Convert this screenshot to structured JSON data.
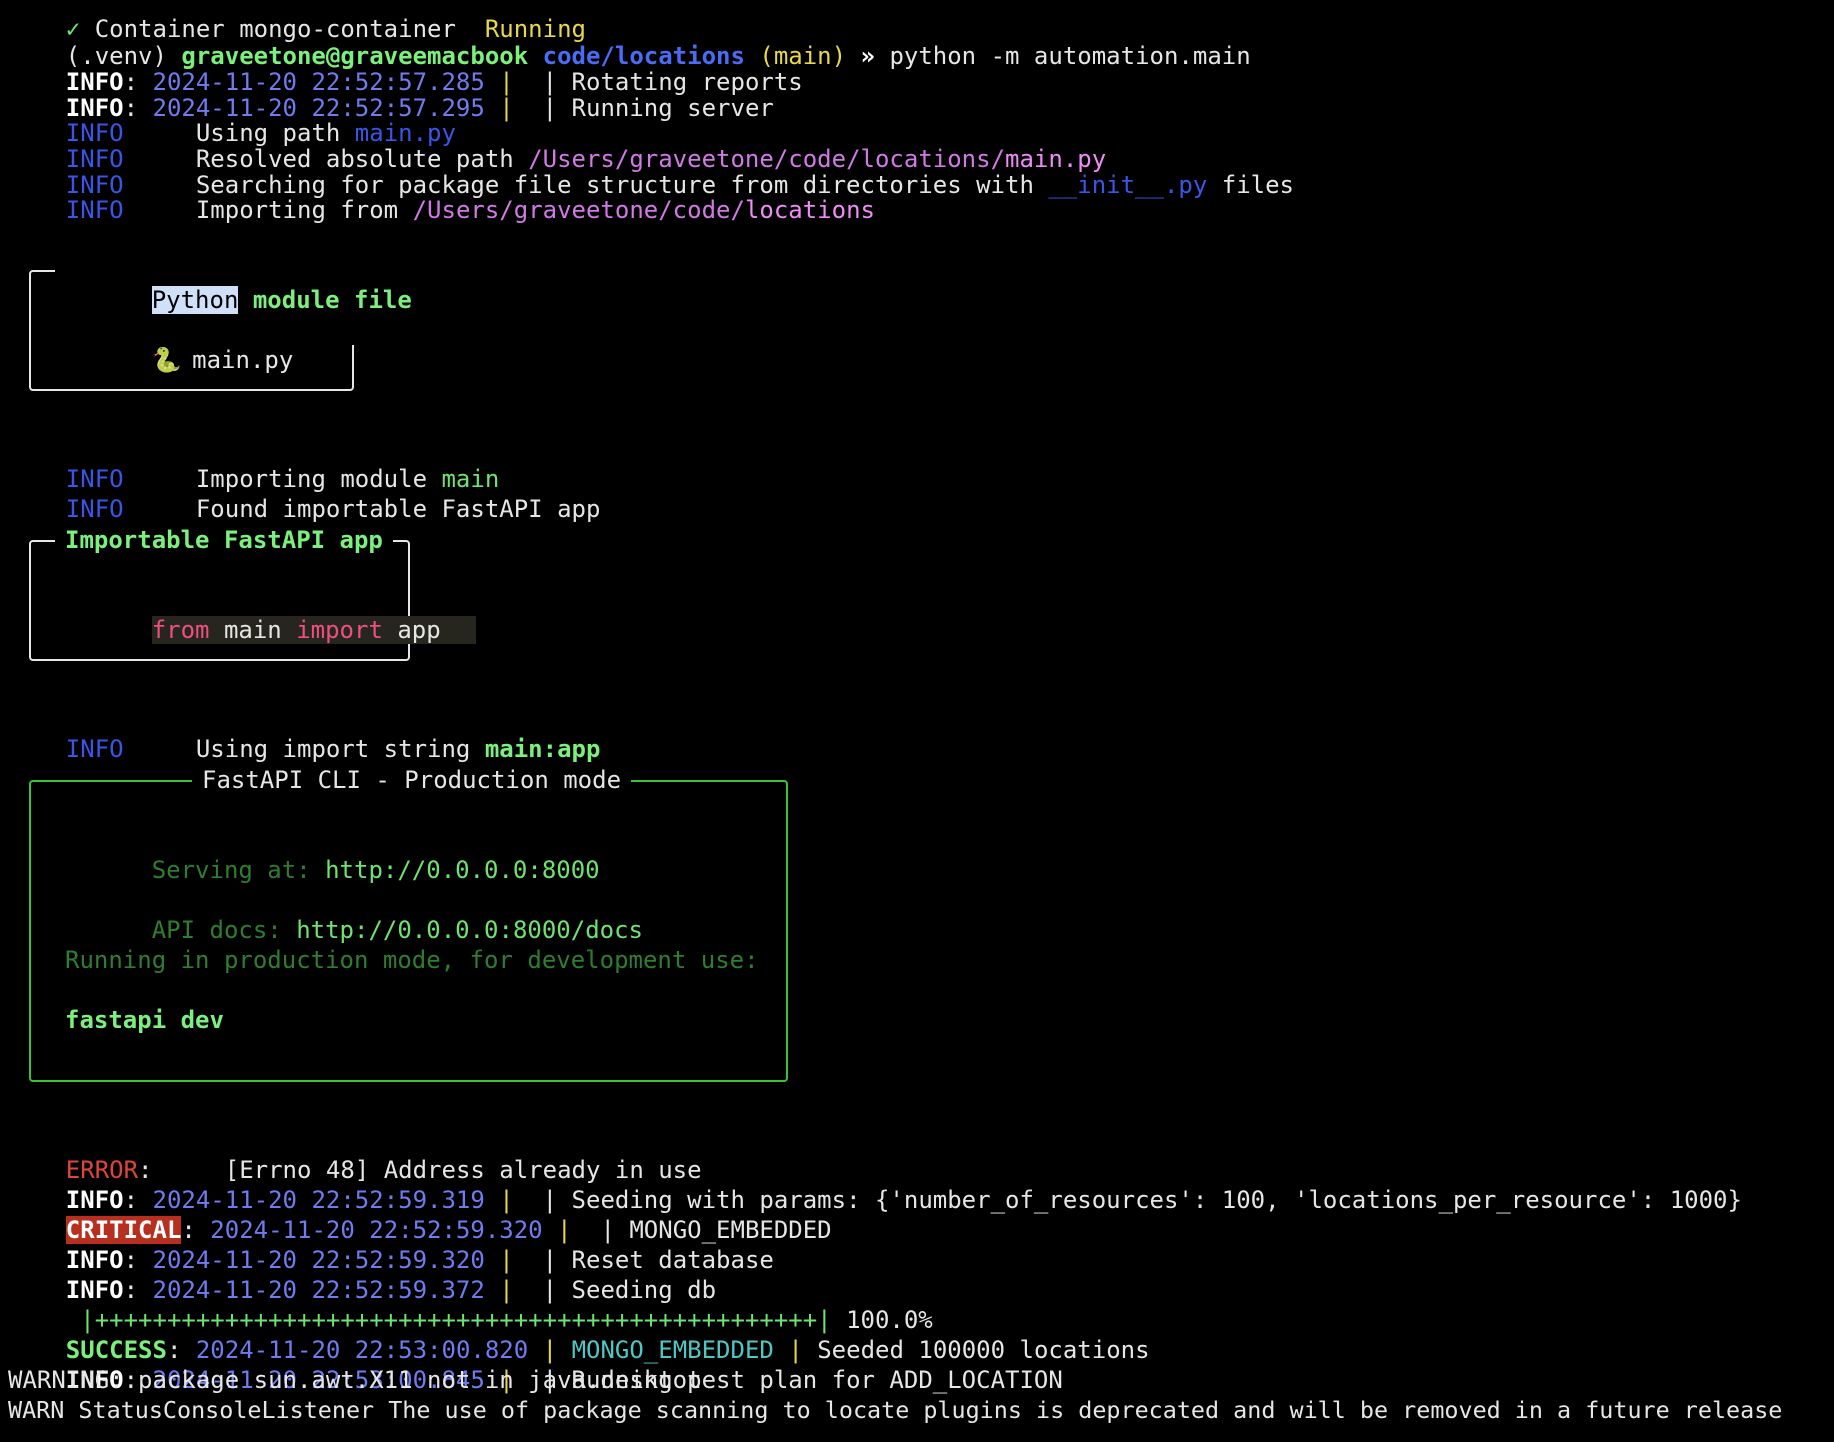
{
  "top_partial": {
    "check": "✓",
    "text": " Container mongo-container  ",
    "status": "Running"
  },
  "prompt": {
    "venv": "(.venv) ",
    "user_host": "graveetone@graveemacbook",
    "path": "code/locations",
    "branch": "(main)",
    "arrow": "»",
    "command": "python -m automation.main"
  },
  "log1": [
    {
      "level": "INFO",
      "time": "2024-11-20 22:52:57.285",
      "msg": "Rotating reports"
    },
    {
      "level": "INFO",
      "time": "2024-11-20 22:52:57.295",
      "msg": "Running server"
    }
  ],
  "cli1": {
    "level": "INFO",
    "using_path_label": "Using path ",
    "using_path_value": "main.py",
    "resolved_label": "Resolved absolute path ",
    "resolved_dir": "/Users/graveetone/code/locations/",
    "resolved_file": "main.py",
    "search_label": "Searching for package file structure from directories with ",
    "search_value": "__init__.py",
    "search_suffix": " files",
    "importing_from_label": "Importing from ",
    "importing_from_dir": "/Users/graveetone/code/",
    "importing_from_leaf": "locations"
  },
  "module_box": {
    "title_hl": "Python",
    "title_rest": " module file",
    "icon": "🐍",
    "file": "main.py"
  },
  "cli2": {
    "level": "INFO",
    "importing_module_label": "Importing module ",
    "importing_module_value": "main",
    "found_app": "Found importable FastAPI app"
  },
  "app_box": {
    "title": "Importable FastAPI app",
    "kw_from": "from",
    "mod": " main ",
    "kw_import": "import",
    "name": " app"
  },
  "cli3": {
    "level": "INFO",
    "import_string_label": "Using import string ",
    "import_string_value": "main:app"
  },
  "prod_box": {
    "title": "FastAPI CLI - Production mode",
    "serving_label": "Serving at: ",
    "serving_url": "http://0.0.0.0:8000",
    "docs_label": "API docs: ",
    "docs_url": "http://0.0.0.0:8000/docs",
    "note": "Running in production mode, for development use:",
    "dev_cmd": "fastapi dev"
  },
  "error": {
    "level": "ERROR",
    "msg": "    [Errno 48] Address already in use"
  },
  "log2": [
    {
      "level": "INFO",
      "time": "2024-11-20 22:52:59.319",
      "msg": "Seeding with params: {'number_of_resources': 100, 'locations_per_resource': 1000}"
    }
  ],
  "critical": {
    "level": "CRITICAL",
    "time": "2024-11-20 22:52:59.320",
    "msg": "MONGO_EMBEDDED"
  },
  "log3": [
    {
      "level": "INFO",
      "time": "2024-11-20 22:52:59.320",
      "msg": "Reset database"
    },
    {
      "level": "INFO",
      "time": "2024-11-20 22:52:59.372",
      "msg": "Seeding db"
    }
  ],
  "progress": {
    "bar": "|++++++++++++++++++++++++++++++++++++++++++++++++++|",
    "percent": "100.0%",
    "fraction": 1.0
  },
  "success": {
    "level": "SUCCESS",
    "time": "2024-11-20 22:53:00.820",
    "source": "MONGO_EMBEDDED",
    "msg": "Seeded 100000 locations"
  },
  "log4": [
    {
      "level": "INFO",
      "time": "2024-11-20 22:53:00.845",
      "msg": "Running test plan for ADD_LOCATION"
    }
  ],
  "warning1": "WARNING: package sun.awt.X11 not in java.desktop",
  "warning2": "WARN StatusConsoleListener The use of package scanning to locate plugins is deprecated and will be removed in a future release"
}
